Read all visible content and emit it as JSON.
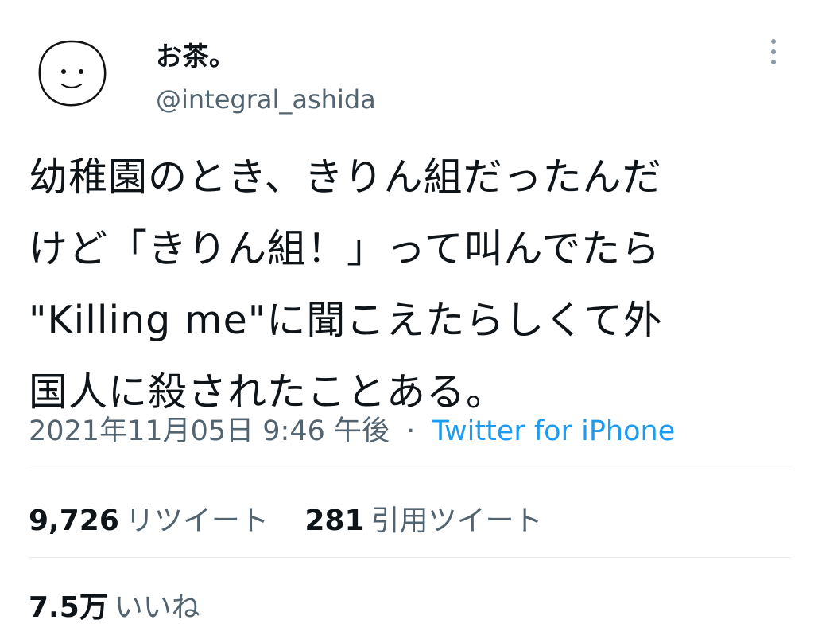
{
  "user": {
    "display_name": "お茶。",
    "handle": "@integral_ashida",
    "avatar_icon": "smiley-face-doodle-icon"
  },
  "menu": {
    "more_icon": "vertical-ellipsis-icon"
  },
  "tweet": {
    "lines": [
      "幼稚園のとき、きりん組だったんだ",
      "けど「きりん組！」って叫んでたら",
      "\"Killing me\"に聞こえたらしくて外",
      "国人に殺されたことある。"
    ]
  },
  "meta": {
    "timestamp": "2021年11月05日 9:46 午後",
    "separator": "·",
    "source": "Twitter for iPhone"
  },
  "stats": {
    "retweets": {
      "count": "9,726",
      "label": "リツイート"
    },
    "quotes": {
      "count": "281",
      "label": "引用ツイート"
    },
    "likes": {
      "count": "7.5万",
      "label": "いいね"
    }
  },
  "colors": {
    "text": "#0f1419",
    "secondary": "#536471",
    "link": "#1d9bf0",
    "divider": "#e6ecf0"
  }
}
